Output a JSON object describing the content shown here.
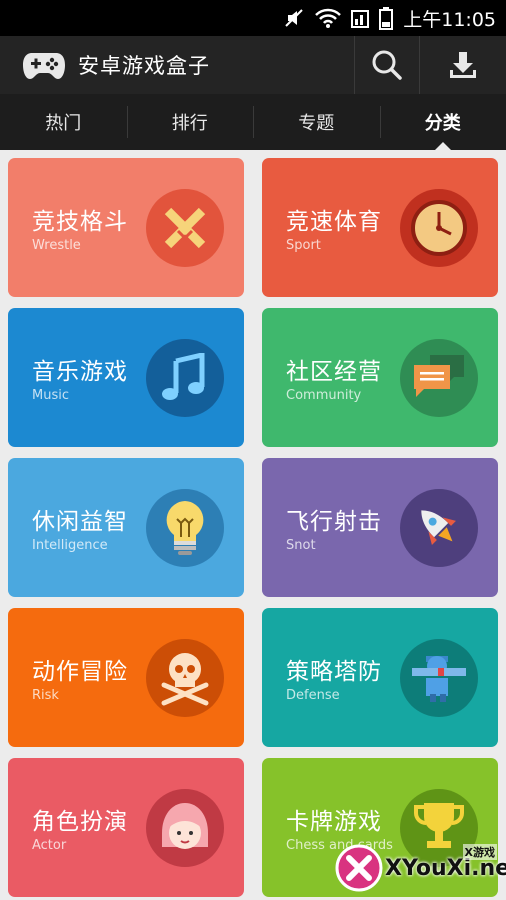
{
  "status": {
    "time": "上午11:05"
  },
  "app": {
    "title": "安卓游戏盒子"
  },
  "tabs": [
    {
      "label": "热门"
    },
    {
      "label": "排行"
    },
    {
      "label": "专题"
    },
    {
      "label": "分类",
      "active": true
    }
  ],
  "categories": [
    {
      "cn": "竞技格斗",
      "en": "Wrestle",
      "color": "#f27e6a",
      "circle": "#e2543c",
      "icon": "crossed-swords-icon"
    },
    {
      "cn": "竞速体育",
      "en": "Sport",
      "color": "#e85b40",
      "circle": "#c0301f",
      "icon": "clock-icon"
    },
    {
      "cn": "音乐游戏",
      "en": "Music",
      "color": "#1c89d1",
      "circle": "#135f9a",
      "icon": "music-note-icon"
    },
    {
      "cn": "社区经营",
      "en": "Community",
      "color": "#3fb86d",
      "circle": "#2f8d54",
      "icon": "chat-bubble-icon"
    },
    {
      "cn": "休闲益智",
      "en": "Intelligence",
      "color": "#4ba8df",
      "circle": "#2d7fb5",
      "icon": "lightbulb-icon"
    },
    {
      "cn": "飞行射击",
      "en": "Snot",
      "color": "#7a67ad",
      "circle": "#4e3f7d",
      "icon": "rocket-icon"
    },
    {
      "cn": "动作冒险",
      "en": "Risk",
      "color": "#f56b0e",
      "circle": "#cc4e06",
      "icon": "skull-icon"
    },
    {
      "cn": "策略塔防",
      "en": "Defense",
      "color": "#16a7a2",
      "circle": "#0d7d79",
      "icon": "tower-defense-icon"
    },
    {
      "cn": "角色扮演",
      "en": "Actor",
      "color": "#ea5b64",
      "circle": "#c03a44",
      "icon": "character-face-icon"
    },
    {
      "cn": "卡牌游戏",
      "en": "Chess and cards",
      "color": "#86c22a",
      "circle": "#5f9416",
      "icon": "trophy-icon"
    }
  ],
  "watermark": {
    "text": "XYouXi.net",
    "small": "X游戏"
  }
}
